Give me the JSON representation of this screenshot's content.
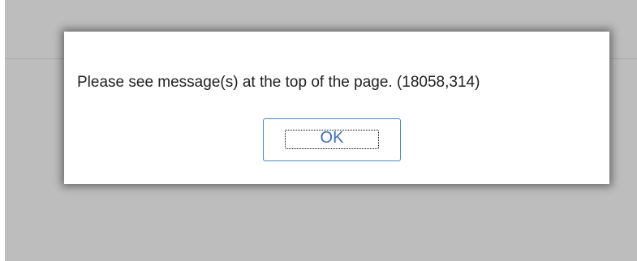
{
  "dialog": {
    "message": "Please see message(s) at the top of the page. (18058,314)",
    "ok_label": "OK"
  },
  "colors": {
    "backdrop": "#bdbdbd",
    "dialog_background": "#ffffff",
    "button_border": "#4a86c8",
    "button_text": "#3f6fb5",
    "message_text": "#222222"
  }
}
